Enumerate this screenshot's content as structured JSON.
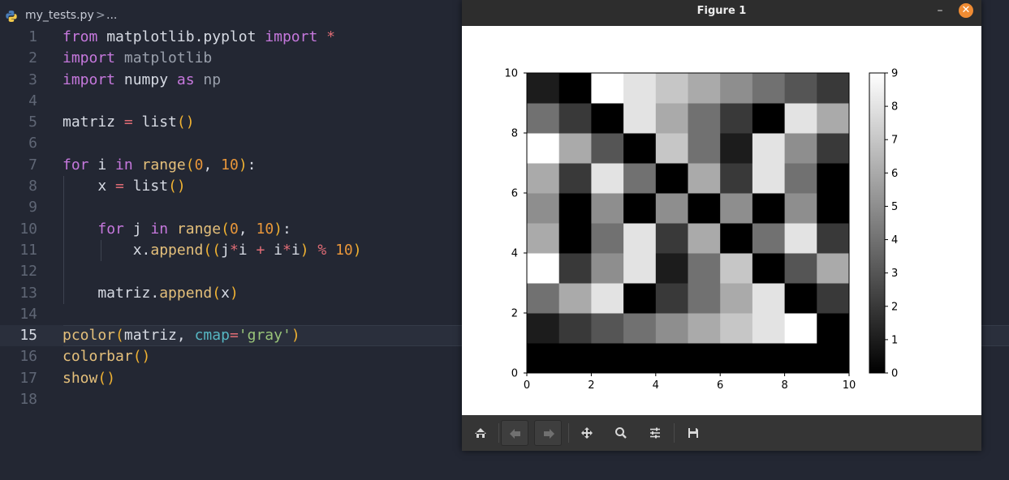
{
  "breadcrumb": {
    "file": "my_tests.py",
    "separator": ">",
    "more": "..."
  },
  "editor": {
    "current_line": 15,
    "lines": [
      {
        "n": "1",
        "indent": 0,
        "tokens": [
          [
            "kw",
            "from"
          ],
          [
            "t",
            " matplotlib.pyplot "
          ],
          [
            "kw",
            "import"
          ],
          [
            "t",
            " "
          ],
          [
            "op",
            "*"
          ]
        ]
      },
      {
        "n": "2",
        "indent": 0,
        "tokens": [
          [
            "kw",
            "import"
          ],
          [
            "t",
            " "
          ],
          [
            "mod",
            "matplotlib"
          ]
        ]
      },
      {
        "n": "3",
        "indent": 0,
        "tokens": [
          [
            "kw",
            "import"
          ],
          [
            "t",
            " numpy "
          ],
          [
            "kw",
            "as"
          ],
          [
            "t",
            " "
          ],
          [
            "mod",
            "np"
          ]
        ]
      },
      {
        "n": "4",
        "indent": 0,
        "tokens": []
      },
      {
        "n": "5",
        "indent": 0,
        "tokens": [
          [
            "t",
            "matriz "
          ],
          [
            "op",
            "="
          ],
          [
            "t",
            " list"
          ],
          [
            "br",
            "()"
          ]
        ]
      },
      {
        "n": "6",
        "indent": 0,
        "tokens": []
      },
      {
        "n": "7",
        "indent": 0,
        "tokens": [
          [
            "kw",
            "for"
          ],
          [
            "t",
            " i "
          ],
          [
            "kw",
            "in"
          ],
          [
            "t",
            " "
          ],
          [
            "fn",
            "range"
          ],
          [
            "br",
            "("
          ],
          [
            "num",
            "0"
          ],
          [
            "t",
            ", "
          ],
          [
            "num",
            "10"
          ],
          [
            "br",
            ")"
          ],
          [
            "t",
            ":"
          ]
        ]
      },
      {
        "n": "8",
        "indent": 1,
        "tokens": [
          [
            "t",
            "    x "
          ],
          [
            "op",
            "="
          ],
          [
            "t",
            " list"
          ],
          [
            "br",
            "()"
          ]
        ]
      },
      {
        "n": "9",
        "indent": 1,
        "tokens": []
      },
      {
        "n": "10",
        "indent": 1,
        "tokens": [
          [
            "t",
            "    "
          ],
          [
            "kw",
            "for"
          ],
          [
            "t",
            " j "
          ],
          [
            "kw",
            "in"
          ],
          [
            "t",
            " "
          ],
          [
            "fn",
            "range"
          ],
          [
            "br",
            "("
          ],
          [
            "num",
            "0"
          ],
          [
            "t",
            ", "
          ],
          [
            "num",
            "10"
          ],
          [
            "br",
            ")"
          ],
          [
            "t",
            ":"
          ]
        ]
      },
      {
        "n": "11",
        "indent": 2,
        "tokens": [
          [
            "t",
            "        x."
          ],
          [
            "fn",
            "append"
          ],
          [
            "br",
            "(("
          ],
          [
            "t",
            "j"
          ],
          [
            "op",
            "*"
          ],
          [
            "t",
            "i "
          ],
          [
            "op",
            "+"
          ],
          [
            "t",
            " i"
          ],
          [
            "op",
            "*"
          ],
          [
            "t",
            "i"
          ],
          [
            "br",
            ")"
          ],
          [
            "t",
            " "
          ],
          [
            "op",
            "%"
          ],
          [
            "t",
            " "
          ],
          [
            "num",
            "10"
          ],
          [
            "br",
            ")"
          ]
        ]
      },
      {
        "n": "12",
        "indent": 1,
        "tokens": []
      },
      {
        "n": "13",
        "indent": 1,
        "tokens": [
          [
            "t",
            "    matriz."
          ],
          [
            "fn",
            "append"
          ],
          [
            "br",
            "("
          ],
          [
            "t",
            "x"
          ],
          [
            "br",
            ")"
          ]
        ]
      },
      {
        "n": "14",
        "indent": 0,
        "tokens": []
      },
      {
        "n": "15",
        "indent": 0,
        "tokens": [
          [
            "fn",
            "pcolor"
          ],
          [
            "br",
            "("
          ],
          [
            "t",
            "matriz, "
          ],
          [
            "arg",
            "cmap"
          ],
          [
            "op",
            "="
          ],
          [
            "str",
            "'gray'"
          ],
          [
            "br",
            ")"
          ]
        ]
      },
      {
        "n": "16",
        "indent": 0,
        "tokens": [
          [
            "fn",
            "colorbar"
          ],
          [
            "br",
            "()"
          ]
        ]
      },
      {
        "n": "17",
        "indent": 0,
        "tokens": [
          [
            "fn",
            "show"
          ],
          [
            "br",
            "()"
          ]
        ]
      },
      {
        "n": "18",
        "indent": 0,
        "tokens": []
      }
    ]
  },
  "figure": {
    "title": "Figure 1",
    "minimize_glyph": "–",
    "close_glyph": "✕",
    "colors": {
      "titlebar": "#2d2d2d",
      "close": "#f08c33",
      "toolbar": "#353535"
    },
    "toolbar": [
      {
        "name": "home-button",
        "icon": "home-icon"
      },
      {
        "name": "back-button",
        "icon": "arrow-left-icon"
      },
      {
        "name": "forward-button",
        "icon": "arrow-right-icon"
      },
      {
        "name": "pan-button",
        "icon": "move-icon"
      },
      {
        "name": "zoom-button",
        "icon": "magnifier-icon"
      },
      {
        "name": "configure-subplots-button",
        "icon": "sliders-icon"
      },
      {
        "name": "save-button",
        "icon": "floppy-disk-icon"
      }
    ]
  },
  "chart_data": {
    "type": "heatmap",
    "cmap": "gray",
    "xlim": [
      0,
      10
    ],
    "ylim": [
      0,
      10
    ],
    "x_ticks": [
      "0",
      "2",
      "4",
      "6",
      "8",
      "10"
    ],
    "y_ticks": [
      "0",
      "2",
      "4",
      "6",
      "8",
      "10"
    ],
    "colorbar": {
      "range": [
        0,
        9
      ],
      "ticks": [
        "0",
        "1",
        "2",
        "3",
        "4",
        "5",
        "6",
        "7",
        "8",
        "9"
      ]
    },
    "rows_bottom_to_top": [
      [
        0,
        0,
        0,
        0,
        0,
        0,
        0,
        0,
        0,
        0
      ],
      [
        1,
        2,
        3,
        4,
        5,
        6,
        7,
        8,
        9,
        0
      ],
      [
        4,
        6,
        8,
        0,
        2,
        4,
        6,
        8,
        0,
        2
      ],
      [
        9,
        2,
        5,
        8,
        1,
        4,
        7,
        0,
        3,
        6
      ],
      [
        6,
        0,
        4,
        8,
        2,
        6,
        0,
        4,
        8,
        2
      ],
      [
        5,
        0,
        5,
        0,
        5,
        0,
        5,
        0,
        5,
        0
      ],
      [
        6,
        2,
        8,
        4,
        0,
        6,
        2,
        8,
        4,
        0
      ],
      [
        9,
        6,
        3,
        0,
        7,
        4,
        1,
        8,
        5,
        2
      ],
      [
        4,
        2,
        0,
        8,
        6,
        4,
        2,
        0,
        8,
        6
      ],
      [
        1,
        0,
        9,
        8,
        7,
        6,
        5,
        4,
        3,
        2
      ]
    ]
  }
}
